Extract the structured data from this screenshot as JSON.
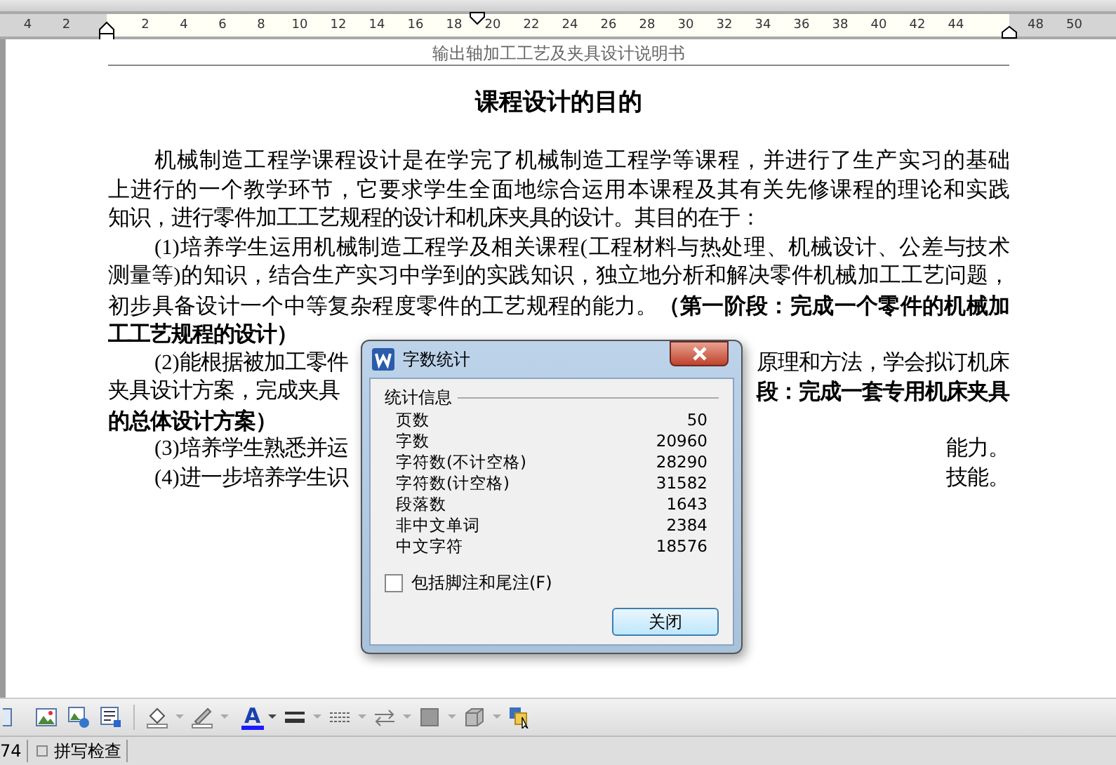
{
  "ruler": {
    "left_labels": [
      "4",
      "2"
    ],
    "labels": [
      "2",
      "4",
      "6",
      "8",
      "10",
      "12",
      "14",
      "16",
      "18",
      "20",
      "22",
      "24",
      "26",
      "28",
      "30",
      "32",
      "34",
      "36",
      "38",
      "40",
      "42",
      "44"
    ],
    "right_labels": [
      "48",
      "50"
    ]
  },
  "document": {
    "header": "输出轴加工工艺及夹具设计说明书",
    "title": "课程设计的目的",
    "lines": [
      {
        "indent": true,
        "last": false,
        "left": [
          {
            "text": "机械制造工程学课程设计是在学完了机械制造工程学等课程，并进行了生产实习的基础",
            "bold": false
          }
        ]
      },
      {
        "indent": false,
        "last": false,
        "left": [
          {
            "text": "上进行的一个教学环节，它要求学生全面地综合运用本课程及其有关先修课程的理论和实践",
            "bold": false
          }
        ]
      },
      {
        "indent": false,
        "last": true,
        "left": [
          {
            "text": "知识，进行零件加工工艺规程的设计和机床夹具的设计。其目的在于：",
            "bold": false
          }
        ]
      },
      {
        "indent": true,
        "last": false,
        "left": [
          {
            "text": "(1)培养学生运用机械制造工程学及相关课程(工程材料与热处理、机械设计、公差与技术",
            "bold": false
          }
        ]
      },
      {
        "indent": false,
        "last": false,
        "left": [
          {
            "text": "测量等)的知识，结合生产实习中学到的实践知识，独立地分析和解决零件机械加工工艺问题，",
            "bold": false
          }
        ]
      },
      {
        "indent": false,
        "last": false,
        "left": [
          {
            "text": "初步具备设计一个中等复杂程度零件的工艺规程的能力。",
            "bold": false
          },
          {
            "text": "（第一阶段：完成一个零件的机械加",
            "bold": true
          }
        ]
      },
      {
        "indent": false,
        "last": true,
        "left": [
          {
            "text": "工工艺规程的设计）",
            "bold": true
          }
        ]
      },
      {
        "indent": true,
        "left": [
          {
            "text": "(2)能根据被加工零件",
            "bold": false
          }
        ],
        "right": [
          {
            "text": "原理和方法，学会拟订机床",
            "bold": false
          }
        ]
      },
      {
        "indent": false,
        "left": [
          {
            "text": "夹具设计方案，完成夹具",
            "bold": false
          }
        ],
        "right": [
          {
            "text": "段：完成一套专用机床夹具",
            "bold": true
          }
        ]
      },
      {
        "indent": false,
        "last": true,
        "left": [
          {
            "text": "的总体设计方案）",
            "bold": true
          }
        ]
      },
      {
        "indent": true,
        "left": [
          {
            "text": "(3)培养学生熟悉并运",
            "bold": false
          }
        ],
        "right": [
          {
            "text": "能力。",
            "bold": false
          }
        ]
      },
      {
        "indent": true,
        "left": [
          {
            "text": "(4)进一步培养学生识",
            "bold": false
          }
        ],
        "right": [
          {
            "text": "技能。",
            "bold": false
          }
        ]
      }
    ]
  },
  "dialog": {
    "title": "字数统计",
    "group": "统计信息",
    "rows": [
      {
        "label": "页数",
        "value": "50"
      },
      {
        "label": "字数",
        "value": "20960"
      },
      {
        "label": "字符数(不计空格)",
        "value": "28290"
      },
      {
        "label": "字符数(计空格)",
        "value": "31582"
      },
      {
        "label": "段落数",
        "value": "1643"
      },
      {
        "label": "非中文单词",
        "value": "2384"
      },
      {
        "label": "中文字符",
        "value": "18576"
      }
    ],
    "checkbox": {
      "label": "包括脚注和尾注(F)",
      "checked": false
    },
    "button": "关闭"
  },
  "toolbar": {
    "font_color_glyph": "A"
  },
  "status_bar": {
    "page_count": "74",
    "spell_check": "拼写检查"
  }
}
